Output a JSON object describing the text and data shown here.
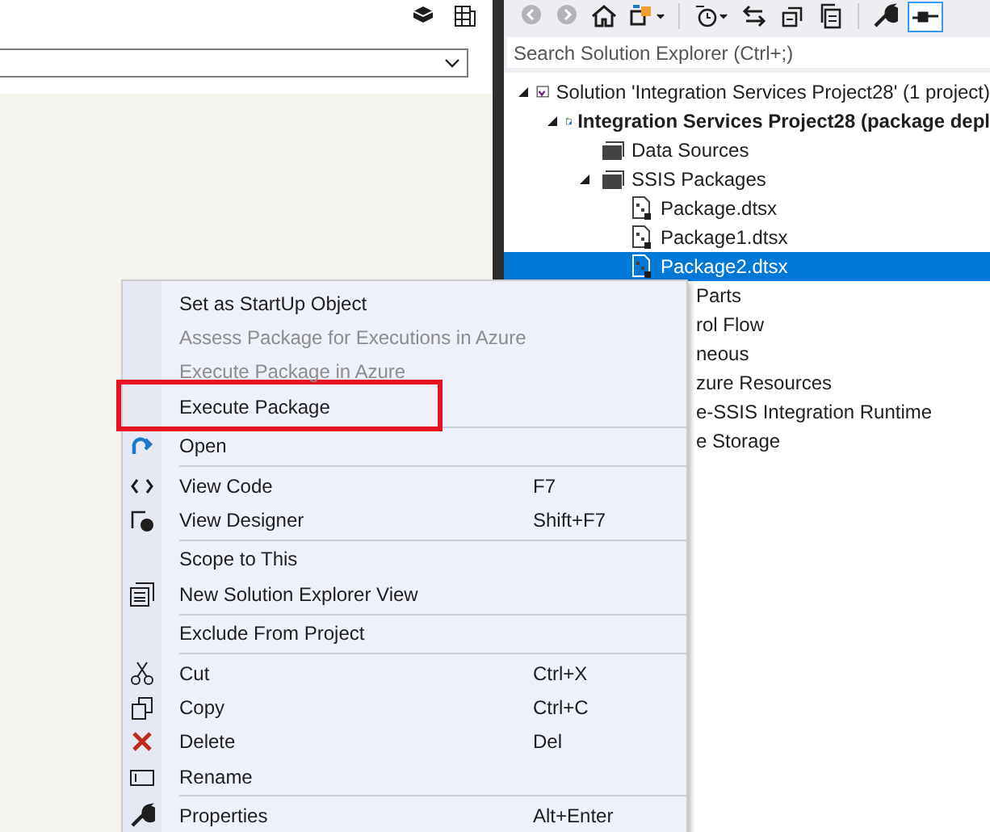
{
  "solution_explorer": {
    "toolbar": [
      {
        "kind": "back",
        "disabled": true
      },
      {
        "kind": "forward",
        "disabled": true
      },
      {
        "kind": "home",
        "disabled": false
      },
      {
        "kind": "sync",
        "disabled": false
      },
      {
        "kind": "history",
        "disabled": false
      },
      {
        "kind": "swap",
        "disabled": false
      },
      {
        "kind": "collapse",
        "disabled": false
      },
      {
        "kind": "copy",
        "disabled": false
      },
      {
        "kind": "wrench",
        "disabled": false
      },
      {
        "kind": "pin",
        "disabled": false
      }
    ],
    "search": {
      "placeholder": "Search Solution Explorer (Ctrl+;)"
    },
    "tree": [
      {
        "kind": "solution",
        "label": "Solution 'Integration Services Project28' (1 project)",
        "selected": false,
        "children": [
          {
            "kind": "project",
            "label": "Integration Services Project28 (package depl",
            "selected": false,
            "expanded": true,
            "children": [
              {
                "kind": "folder",
                "label": "Data Sources",
                "selected": false
              },
              {
                "kind": "folder",
                "label": "SSIS Packages",
                "selected": false,
                "expanded": true,
                "children": [
                  {
                    "kind": "package",
                    "label": "Package.dtsx",
                    "selected": false
                  },
                  {
                    "kind": "package",
                    "label": "Package1.dtsx",
                    "selected": false
                  },
                  {
                    "kind": "package",
                    "label": "Package2.dtsx",
                    "selected": true
                  }
                ]
              },
              {
                "kind": "clipped",
                "label": "Parts",
                "selected": false
              },
              {
                "kind": "clipped",
                "label": "rol Flow",
                "selected": false
              },
              {
                "kind": "clipped",
                "label": "neous",
                "selected": false
              },
              {
                "kind": "clipped",
                "label": "zure Resources",
                "selected": false
              },
              {
                "kind": "clipped",
                "label": "e-SSIS Integration Runtime",
                "selected": false
              },
              {
                "kind": "clipped",
                "label": "e Storage",
                "selected": false
              }
            ]
          }
        ]
      }
    ]
  },
  "context_menu": {
    "items": [
      {
        "kind": "plain",
        "label": "Set as StartUp Object",
        "disabled": false
      },
      {
        "kind": "plain",
        "label": "Assess Package for Executions in Azure",
        "disabled": true
      },
      {
        "kind": "plain",
        "label": "Execute Package in Azure",
        "disabled": true
      },
      {
        "kind": "plain",
        "label": "Execute Package",
        "disabled": false,
        "boxed": true
      },
      {
        "kind": "separator"
      },
      {
        "kind": "open",
        "label": "Open",
        "disabled": false
      },
      {
        "kind": "separator"
      },
      {
        "kind": "code",
        "label": "View Code",
        "shortcut": "F7",
        "disabled": false
      },
      {
        "kind": "designer",
        "label": "View Designer",
        "shortcut": "Shift+F7",
        "disabled": false
      },
      {
        "kind": "separator"
      },
      {
        "kind": "plain",
        "label": "Scope to This",
        "disabled": false
      },
      {
        "kind": "newview",
        "label": "New Solution Explorer View",
        "disabled": false
      },
      {
        "kind": "separator"
      },
      {
        "kind": "plain",
        "label": "Exclude From Project",
        "disabled": false
      },
      {
        "kind": "separator"
      },
      {
        "kind": "cut",
        "label": "Cut",
        "shortcut": "Ctrl+X",
        "disabled": false
      },
      {
        "kind": "copy",
        "label": "Copy",
        "shortcut": "Ctrl+C",
        "disabled": false
      },
      {
        "kind": "delete",
        "label": "Delete",
        "shortcut": "Del",
        "disabled": false
      },
      {
        "kind": "rename",
        "label": "Rename",
        "disabled": false
      },
      {
        "kind": "separator"
      },
      {
        "kind": "wrench",
        "label": "Properties",
        "shortcut": "Alt+Enter",
        "disabled": false
      }
    ]
  }
}
